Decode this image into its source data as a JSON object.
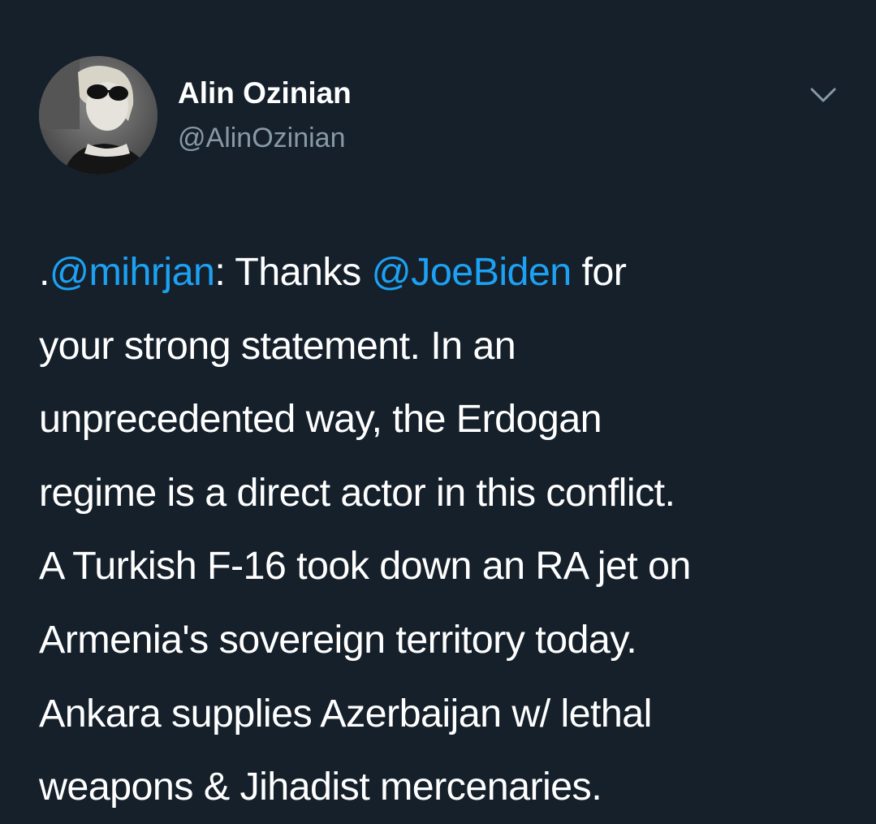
{
  "tweet": {
    "author": {
      "display_name": "Alin Ozinian",
      "handle": "@AlinOzinian",
      "avatar_icon": "profile-photo"
    },
    "menu_icon": "chevron-down-icon",
    "colors": {
      "background": "#15202b",
      "text": "#ffffff",
      "secondary_text": "#8899a6",
      "link": "#1da1f2"
    },
    "text": {
      "line1_prefix": ".",
      "line1_mention1": "@mihrjan",
      "line1_mid": ": Thanks ",
      "line1_mention2": "@JoeBiden",
      "line1_suffix": " for",
      "line2": "your strong statement. In an",
      "line3": "unprecedented way, the Erdogan",
      "line4": "regime is a direct actor in this conflict.",
      "line5": "A Turkish F-16 took down an RA jet on",
      "line6": "Armenia's sovereign territory today.",
      "line7": "Ankara supplies Azerbaijan w/ lethal",
      "line8": "weapons & Jihadist mercenaries."
    }
  }
}
